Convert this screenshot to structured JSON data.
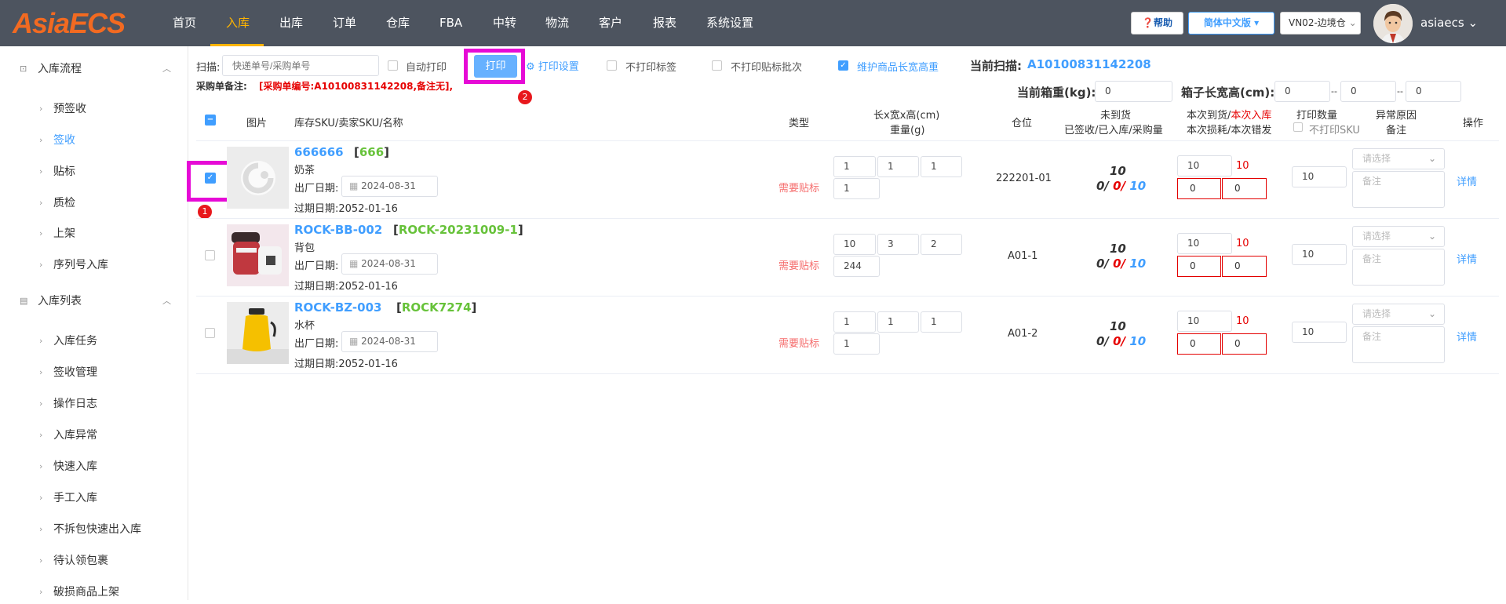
{
  "header": {
    "logo": "AsiaECS",
    "nav": [
      "首页",
      "入库",
      "出库",
      "订单",
      "仓库",
      "FBA",
      "中转",
      "物流",
      "客户",
      "报表",
      "系统设置"
    ],
    "help": "❓帮助",
    "lang": "简体中文版",
    "warehouse": "VN02-边境仓",
    "user": "asiaecs"
  },
  "sidebar": {
    "groups": [
      {
        "label": "入库流程",
        "items": [
          "预签收",
          "签收",
          "贴标",
          "质检",
          "上架",
          "序列号入库"
        ]
      },
      {
        "label": "入库列表",
        "items": [
          "入库任务",
          "签收管理",
          "操作日志",
          "入库异常",
          "快速入库",
          "手工入库",
          "不拆包快速出入库",
          "待认领包裹",
          "破损商品上架"
        ]
      }
    ]
  },
  "toolbar": {
    "scan_label": "扫描:",
    "scan_placeholder": "快递单号/采购单号",
    "auto_print": "自动打印",
    "print": "打印",
    "print_settings": "打印设置",
    "no_print_label": "不打印标签",
    "no_print_batch": "不打印贴标批次",
    "maintain_dims": "维护商品长宽高重",
    "current_scan_label": "当前扫描:",
    "current_scan_value": "A10100831142208",
    "po_note_label": "采购单备注:",
    "po_note_value": "[采购单编号:A10100831142208,备注无],",
    "box_weight_label": "当前箱重(kg):",
    "box_weight": "0",
    "box_dims_label": "箱子长宽高(cm):",
    "box_l": "0",
    "box_w": "0",
    "box_h": "0",
    "dash": "--"
  },
  "annotations": {
    "one": "1",
    "two": "2"
  },
  "table": {
    "headers": {
      "image": "图片",
      "sku": "库存SKU/卖家SKU/名称",
      "type": "类型",
      "dims": "长x宽x高(cm)",
      "weight": "重量(g)",
      "location": "仓位",
      "not_arrived": "未到货",
      "signed": "已签收/已入库/采购量",
      "this_arrival": "本次到货/",
      "this_inbound": "本次入库",
      "this_loss": "本次损耗/本次错发",
      "print_qty": "打印数量",
      "no_print_sku": "不打印SKU",
      "abnormal": "异常原因",
      "remark": "备注",
      "ops": "操作"
    },
    "rows": [
      {
        "sku": "666666",
        "seller_sku": "666",
        "name": "奶茶",
        "mfg_label": "出厂日期:",
        "mfg": "2024-08-31",
        "exp": "过期日期:2052-01-16",
        "type": "需要贴标",
        "l": "1",
        "w": "1",
        "h": "1",
        "wt": "1",
        "loc": "222201-01",
        "pending": "10",
        "signed": "0/",
        "stocked": "0/",
        "purchase": "10",
        "arrive": "10",
        "inbound": "10",
        "loss": "0",
        "wrong": "0",
        "qty": "10",
        "select": "请选择",
        "note": "备注",
        "detail": "详情"
      },
      {
        "sku": "ROCK-BB-002",
        "seller_sku": "ROCK-20231009-1",
        "name": "背包",
        "mfg_label": "出厂日期:",
        "mfg": "2024-08-31",
        "exp": "过期日期:2052-01-16",
        "type": "需要贴标",
        "l": "10",
        "w": "3",
        "h": "2",
        "wt": "244",
        "loc": "A01-1",
        "pending": "10",
        "signed": "0/",
        "stocked": "0/",
        "purchase": "10",
        "arrive": "10",
        "inbound": "10",
        "loss": "0",
        "wrong": "0",
        "qty": "10",
        "select": "请选择",
        "note": "备注",
        "detail": "详情"
      },
      {
        "sku": "ROCK-BZ-003",
        "seller_sku": "ROCK7274",
        "name": "水杯",
        "mfg_label": "出厂日期:",
        "mfg": "2024-08-31",
        "exp": "过期日期:2052-01-16",
        "type": "需要贴标",
        "l": "1",
        "w": "1",
        "h": "1",
        "wt": "1",
        "loc": "A01-2",
        "pending": "10",
        "signed": "0/",
        "stocked": "0/",
        "purchase": "10",
        "arrive": "10",
        "inbound": "10",
        "loss": "0",
        "wrong": "0",
        "qty": "10",
        "select": "请选择",
        "note": "备注",
        "detail": "详情"
      }
    ]
  }
}
